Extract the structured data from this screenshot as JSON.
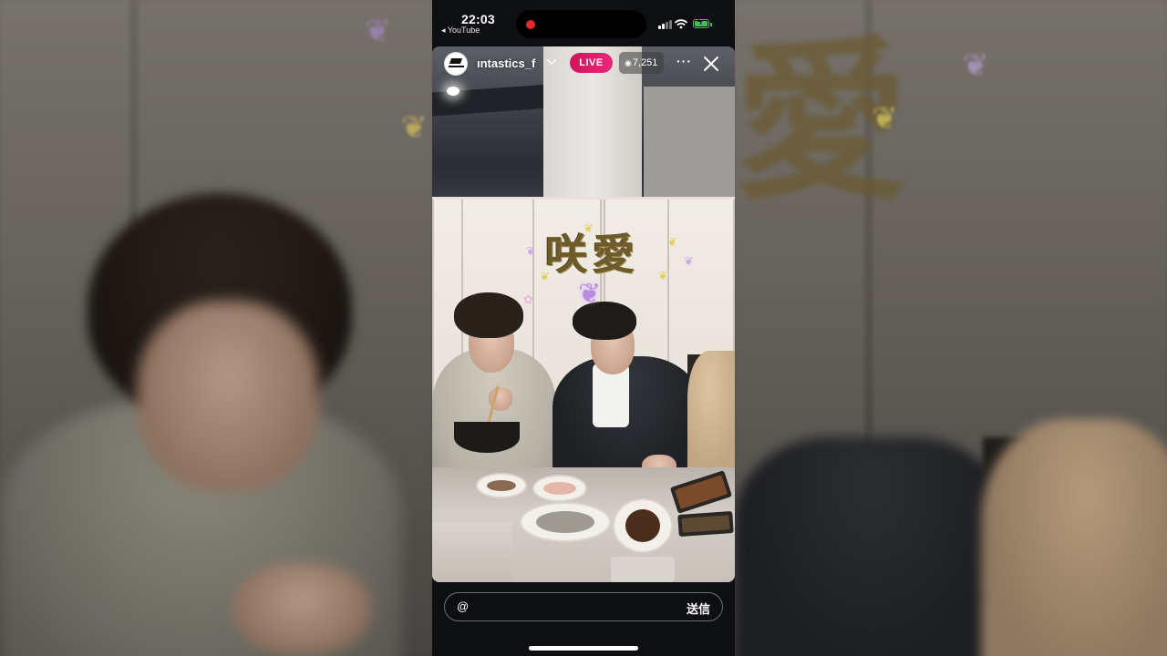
{
  "status_bar": {
    "time": "22:03",
    "back_app": "◂ YouTube",
    "recording": true
  },
  "live": {
    "username": "ıntastics_f",
    "live_label": "LIVE",
    "viewer_count": "7,251",
    "more_label": "···"
  },
  "video": {
    "sign_text": "咲愛"
  },
  "comment": {
    "prefix": "@",
    "value": "",
    "send_label": "送信"
  },
  "colors": {
    "live_badge": "#e0245e",
    "recording_dot": "#e32a2a",
    "battery": "#3ec24a",
    "background": "#0d0f13"
  },
  "icons": {
    "avatar": "fantastics-logo",
    "chevron": "chevron-down-icon",
    "viewers": "eye-icon",
    "close": "close-icon",
    "signal": "signal-icon",
    "wifi": "wifi-icon",
    "battery": "battery-charging-icon"
  }
}
